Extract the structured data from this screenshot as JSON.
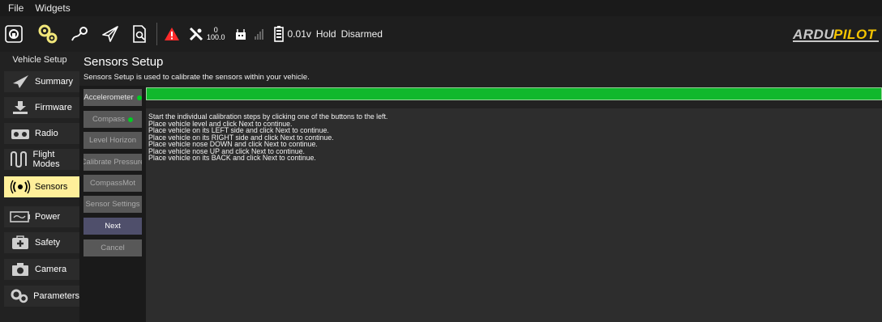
{
  "menu": {
    "file": "File",
    "widgets": "Widgets"
  },
  "toolbar": {
    "gps_count": "0",
    "gps_hdop": "100.0",
    "battery": "0.01v",
    "mode": "Hold",
    "arm_state": "Disarmed",
    "logo_text": "ARDUPILOT",
    "icons": [
      "qgc-logo-icon",
      "vehicle-setup-gear-icon",
      "plan-waypoint-icon",
      "fly-paper-plane-icon",
      "analyze-document-icon",
      "warning-triangle-icon",
      "satellite-icon",
      "rc-signal-icon",
      "battery-icon"
    ]
  },
  "leftnav": {
    "title": "Vehicle Setup",
    "items": [
      {
        "label": "Summary",
        "icon": "summary-plane-icon"
      },
      {
        "label": "Firmware",
        "icon": "firmware-download-icon"
      },
      {
        "label": "Radio",
        "icon": "radio-transmitter-icon"
      },
      {
        "label": "Flight Modes",
        "icon": "flight-modes-wave-icon"
      },
      {
        "label": "Sensors",
        "icon": "sensors-radio-waves-icon",
        "active": true
      },
      {
        "label": "Power",
        "icon": "power-battery-icon"
      },
      {
        "label": "Safety",
        "icon": "safety-cross-icon"
      },
      {
        "label": "Camera",
        "icon": "camera-icon"
      },
      {
        "label": "Parameters",
        "icon": "parameters-gears-icon"
      }
    ]
  },
  "main": {
    "title": "Sensors Setup",
    "description": "Sensors Setup is used to calibrate the sensors within your vehicle.",
    "buttons": {
      "accelerometer": "Accelerometer",
      "compass": "Compass",
      "level_horizon": "Level Horizon",
      "calibrate_pressure": "Calibrate Pressure",
      "compassmot": "CompassMot",
      "sensor_settings": "Sensor Settings",
      "next": "Next",
      "cancel": "Cancel"
    },
    "progress": 1.0,
    "colors": {
      "progress": "#10b82c",
      "active_nav": "#ffef9a",
      "status_ok": "#00cc22"
    },
    "messages": [
      "Start the individual calibration steps by clicking one of the buttons to the left.",
      "Place vehicle level and click Next to continue.",
      "Place vehicle on its LEFT side and click Next to continue.",
      "Place vehicle on its RIGHT side and click Next to continue.",
      "Place vehicle nose DOWN and click Next to continue.",
      "Place vehicle nose UP and click Next to continue.",
      "Place vehicle on its BACK and click Next to continue."
    ]
  }
}
